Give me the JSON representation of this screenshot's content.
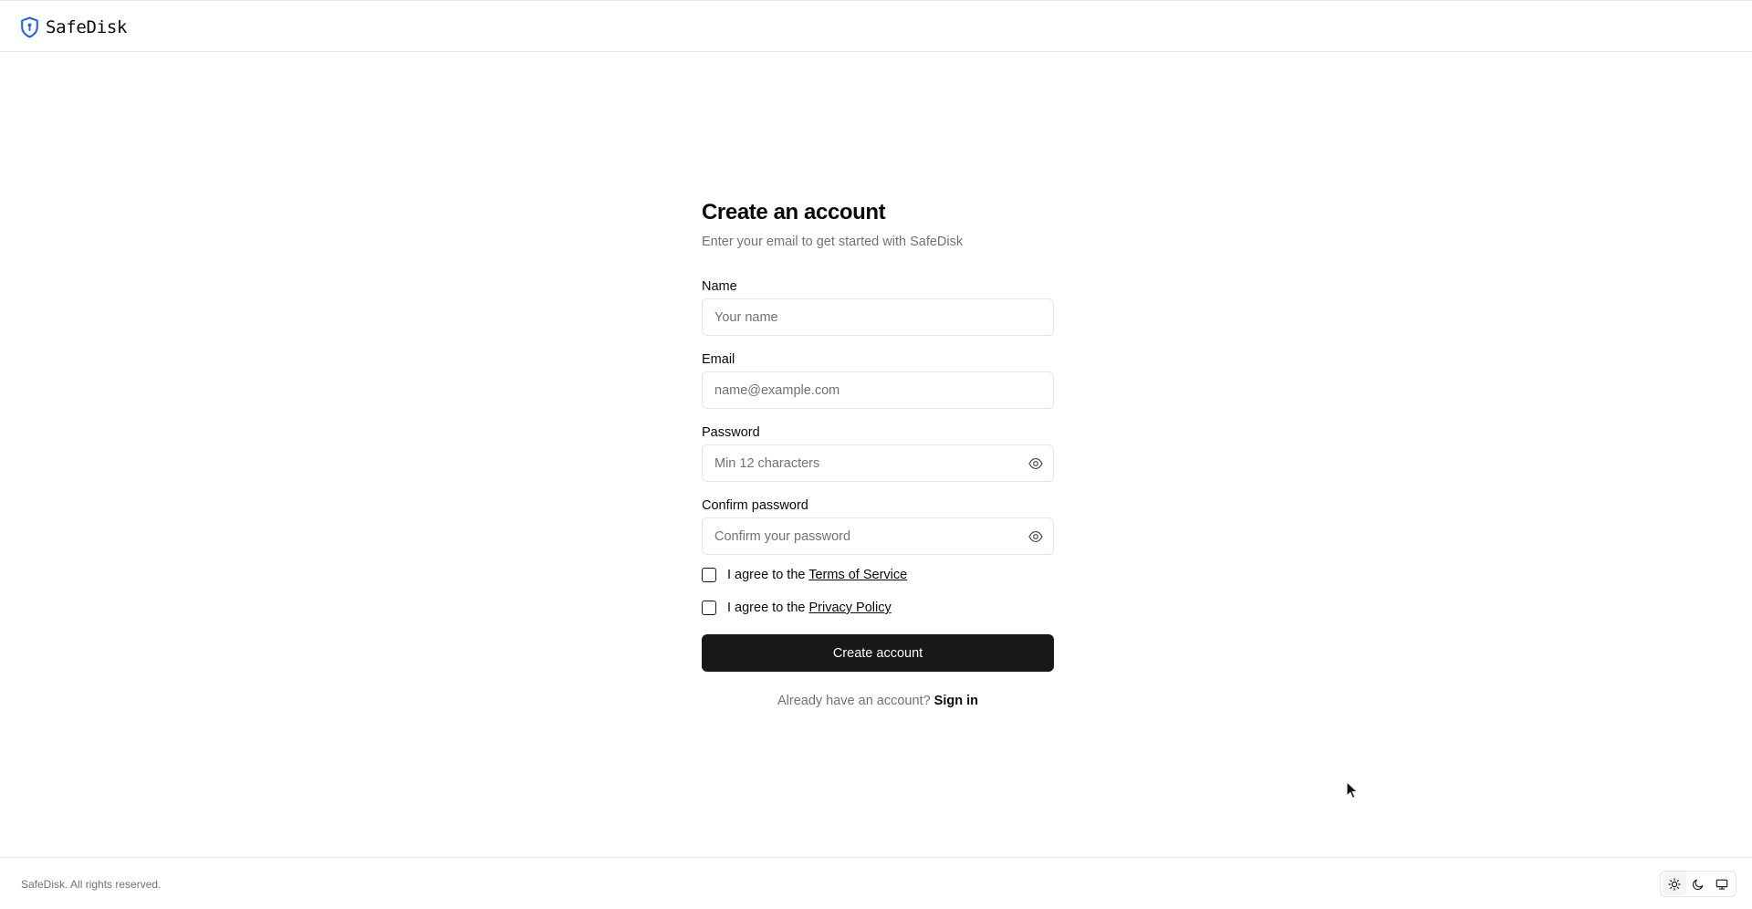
{
  "header": {
    "brand_name": "SafeDisk",
    "brand_icon": "shield-icon",
    "accent_color": "#2563eb"
  },
  "form": {
    "title": "Create an account",
    "subtitle": "Enter your email to get started with SafeDisk",
    "fields": {
      "name": {
        "label": "Name",
        "placeholder": "Your name",
        "value": ""
      },
      "email": {
        "label": "Email",
        "placeholder": "name@example.com",
        "value": ""
      },
      "password": {
        "label": "Password",
        "placeholder": "Min 12 characters",
        "value": "",
        "toggle_icon": "eye-icon"
      },
      "confirm_password": {
        "label": "Confirm password",
        "placeholder": "Confirm your password",
        "value": "",
        "toggle_icon": "eye-icon"
      }
    },
    "agreements": {
      "terms": {
        "prefix": "I agree to the",
        "link": "Terms of Service",
        "checked": false
      },
      "privacy": {
        "prefix": "I agree to the",
        "link": "Privacy Policy",
        "checked": false
      }
    },
    "submit_label": "Create account",
    "signin_prompt": "Already have an account?",
    "signin_link": "Sign in"
  },
  "footer": {
    "copyright": "SafeDisk. All rights reserved.",
    "theme_options": [
      "sun-icon",
      "moon-icon",
      "monitor-icon"
    ],
    "active_theme": "sun-icon"
  }
}
